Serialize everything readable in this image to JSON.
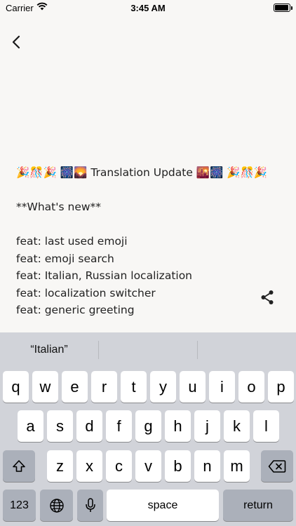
{
  "status": {
    "carrier": "Carrier",
    "time": "3:45 AM"
  },
  "icons": {
    "back": "chevron-left-icon",
    "share": "share-icon",
    "wifi": "wifi-icon",
    "battery": "battery-icon"
  },
  "post": {
    "title": "🎉🎊🎉  🎆🌄 Translation Update 🌇🎆  🎉🎊🎉",
    "heading": "**What's new**",
    "items": [
      "feat: last used emoji",
      "feat: emoji search",
      "feat: Italian, Russian localization",
      "feat: localization switcher",
      "feat: generic greeting"
    ]
  },
  "keyboard": {
    "suggestions": [
      "“Italian”",
      "",
      ""
    ],
    "row1": [
      "q",
      "w",
      "e",
      "r",
      "t",
      "y",
      "u",
      "i",
      "o",
      "p"
    ],
    "row2": [
      "a",
      "s",
      "d",
      "f",
      "g",
      "h",
      "j",
      "k",
      "l"
    ],
    "row3": [
      "z",
      "x",
      "c",
      "v",
      "b",
      "n",
      "m"
    ],
    "numbers_label": "123",
    "space_label": "space",
    "return_label": "return"
  }
}
